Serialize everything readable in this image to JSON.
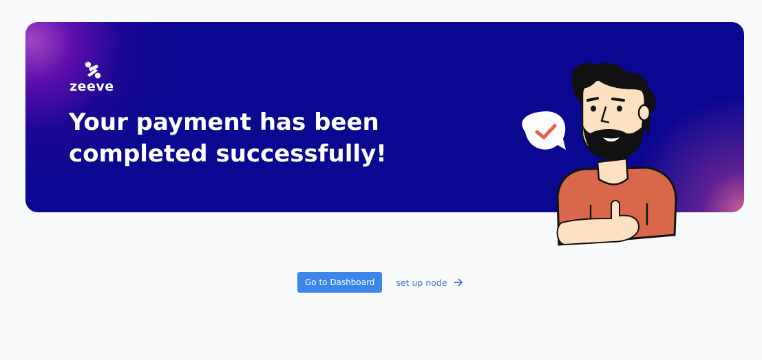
{
  "brand": {
    "name": "zeeve",
    "logo_icon": "zeeve-logo-icon"
  },
  "banner": {
    "headline": "Your payment has been completed successfully!",
    "illustration": "man-thumbs-up-illustration",
    "badge_icon": "checkmark-icon"
  },
  "actions": {
    "primary_label": "Go to Dashboard",
    "secondary_label": "set up node",
    "secondary_icon": "arrow-right-icon"
  },
  "colors": {
    "banner_bg": "#0a0890",
    "primary_button": "#3c86ea",
    "link": "#3c73d6",
    "page_bg": "#f9fafb"
  }
}
